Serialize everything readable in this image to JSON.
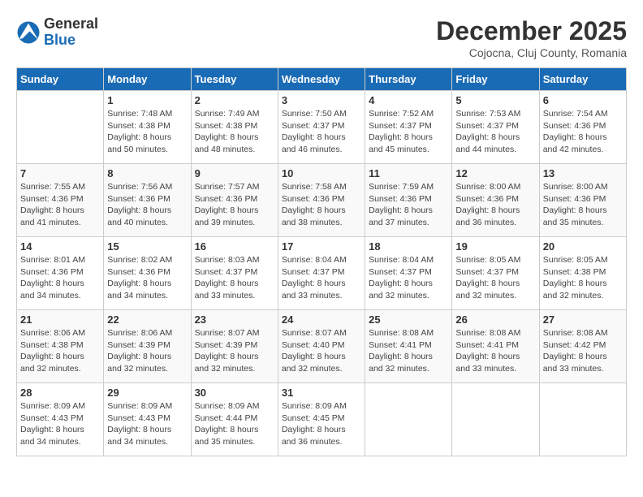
{
  "logo": {
    "general": "General",
    "blue": "Blue"
  },
  "title": "December 2025",
  "subtitle": "Cojocna, Cluj County, Romania",
  "days_header": [
    "Sunday",
    "Monday",
    "Tuesday",
    "Wednesday",
    "Thursday",
    "Friday",
    "Saturday"
  ],
  "weeks": [
    [
      {
        "day": "",
        "info": ""
      },
      {
        "day": "1",
        "info": "Sunrise: 7:48 AM\nSunset: 4:38 PM\nDaylight: 8 hours\nand 50 minutes."
      },
      {
        "day": "2",
        "info": "Sunrise: 7:49 AM\nSunset: 4:38 PM\nDaylight: 8 hours\nand 48 minutes."
      },
      {
        "day": "3",
        "info": "Sunrise: 7:50 AM\nSunset: 4:37 PM\nDaylight: 8 hours\nand 46 minutes."
      },
      {
        "day": "4",
        "info": "Sunrise: 7:52 AM\nSunset: 4:37 PM\nDaylight: 8 hours\nand 45 minutes."
      },
      {
        "day": "5",
        "info": "Sunrise: 7:53 AM\nSunset: 4:37 PM\nDaylight: 8 hours\nand 44 minutes."
      },
      {
        "day": "6",
        "info": "Sunrise: 7:54 AM\nSunset: 4:36 PM\nDaylight: 8 hours\nand 42 minutes."
      }
    ],
    [
      {
        "day": "7",
        "info": "Sunrise: 7:55 AM\nSunset: 4:36 PM\nDaylight: 8 hours\nand 41 minutes."
      },
      {
        "day": "8",
        "info": "Sunrise: 7:56 AM\nSunset: 4:36 PM\nDaylight: 8 hours\nand 40 minutes."
      },
      {
        "day": "9",
        "info": "Sunrise: 7:57 AM\nSunset: 4:36 PM\nDaylight: 8 hours\nand 39 minutes."
      },
      {
        "day": "10",
        "info": "Sunrise: 7:58 AM\nSunset: 4:36 PM\nDaylight: 8 hours\nand 38 minutes."
      },
      {
        "day": "11",
        "info": "Sunrise: 7:59 AM\nSunset: 4:36 PM\nDaylight: 8 hours\nand 37 minutes."
      },
      {
        "day": "12",
        "info": "Sunrise: 8:00 AM\nSunset: 4:36 PM\nDaylight: 8 hours\nand 36 minutes."
      },
      {
        "day": "13",
        "info": "Sunrise: 8:00 AM\nSunset: 4:36 PM\nDaylight: 8 hours\nand 35 minutes."
      }
    ],
    [
      {
        "day": "14",
        "info": "Sunrise: 8:01 AM\nSunset: 4:36 PM\nDaylight: 8 hours\nand 34 minutes."
      },
      {
        "day": "15",
        "info": "Sunrise: 8:02 AM\nSunset: 4:36 PM\nDaylight: 8 hours\nand 34 minutes."
      },
      {
        "day": "16",
        "info": "Sunrise: 8:03 AM\nSunset: 4:37 PM\nDaylight: 8 hours\nand 33 minutes."
      },
      {
        "day": "17",
        "info": "Sunrise: 8:04 AM\nSunset: 4:37 PM\nDaylight: 8 hours\nand 33 minutes."
      },
      {
        "day": "18",
        "info": "Sunrise: 8:04 AM\nSunset: 4:37 PM\nDaylight: 8 hours\nand 32 minutes."
      },
      {
        "day": "19",
        "info": "Sunrise: 8:05 AM\nSunset: 4:37 PM\nDaylight: 8 hours\nand 32 minutes."
      },
      {
        "day": "20",
        "info": "Sunrise: 8:05 AM\nSunset: 4:38 PM\nDaylight: 8 hours\nand 32 minutes."
      }
    ],
    [
      {
        "day": "21",
        "info": "Sunrise: 8:06 AM\nSunset: 4:38 PM\nDaylight: 8 hours\nand 32 minutes."
      },
      {
        "day": "22",
        "info": "Sunrise: 8:06 AM\nSunset: 4:39 PM\nDaylight: 8 hours\nand 32 minutes."
      },
      {
        "day": "23",
        "info": "Sunrise: 8:07 AM\nSunset: 4:39 PM\nDaylight: 8 hours\nand 32 minutes."
      },
      {
        "day": "24",
        "info": "Sunrise: 8:07 AM\nSunset: 4:40 PM\nDaylight: 8 hours\nand 32 minutes."
      },
      {
        "day": "25",
        "info": "Sunrise: 8:08 AM\nSunset: 4:41 PM\nDaylight: 8 hours\nand 32 minutes."
      },
      {
        "day": "26",
        "info": "Sunrise: 8:08 AM\nSunset: 4:41 PM\nDaylight: 8 hours\nand 33 minutes."
      },
      {
        "day": "27",
        "info": "Sunrise: 8:08 AM\nSunset: 4:42 PM\nDaylight: 8 hours\nand 33 minutes."
      }
    ],
    [
      {
        "day": "28",
        "info": "Sunrise: 8:09 AM\nSunset: 4:43 PM\nDaylight: 8 hours\nand 34 minutes."
      },
      {
        "day": "29",
        "info": "Sunrise: 8:09 AM\nSunset: 4:43 PM\nDaylight: 8 hours\nand 34 minutes."
      },
      {
        "day": "30",
        "info": "Sunrise: 8:09 AM\nSunset: 4:44 PM\nDaylight: 8 hours\nand 35 minutes."
      },
      {
        "day": "31",
        "info": "Sunrise: 8:09 AM\nSunset: 4:45 PM\nDaylight: 8 hours\nand 36 minutes."
      },
      {
        "day": "",
        "info": ""
      },
      {
        "day": "",
        "info": ""
      },
      {
        "day": "",
        "info": ""
      }
    ]
  ]
}
